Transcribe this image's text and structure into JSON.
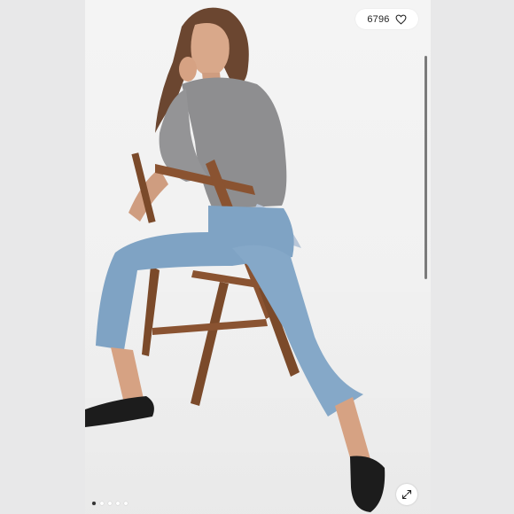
{
  "likes": {
    "count": "6796",
    "icon": "heart-outline-icon"
  },
  "carousel": {
    "total": 5,
    "active_index": 0
  },
  "expand": {
    "icon": "expand-icon"
  },
  "colors": {
    "background": "#e9e9ea",
    "photo_bg": "#f2f2f2",
    "badge_bg": "#ffffff"
  }
}
